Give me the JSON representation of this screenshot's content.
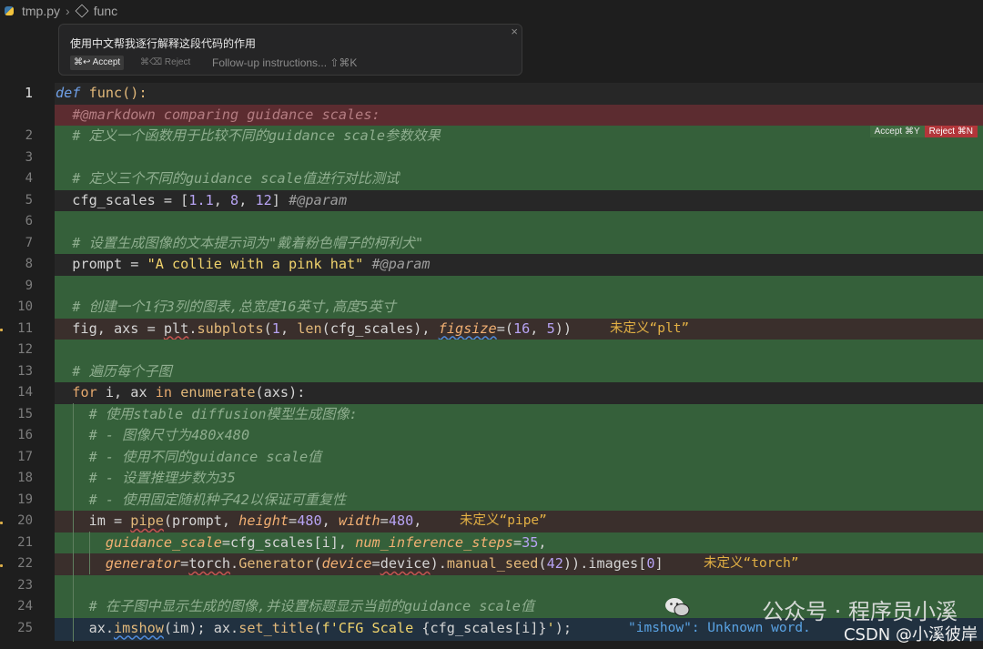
{
  "breadcrumb": {
    "file": "tmp.py",
    "symbol": "func"
  },
  "prompt_panel": {
    "prompt": "使用中文帮我逐行解释这段代码的作用",
    "accept": "⌘↩ Accept",
    "reject": "⌘⌫ Reject",
    "followup_placeholder": "Follow-up instructions... ⇧⌘K",
    "close": "×"
  },
  "diff_buttons": {
    "accept": "Accept ⌘Y",
    "reject": "Reject ⌘N"
  },
  "lines": {
    "l1": {
      "num": "1"
    },
    "l2": {
      "num": "2"
    },
    "l3": {
      "num": "3"
    },
    "l4": {
      "num": "4"
    },
    "l5": {
      "num": "5"
    },
    "l6": {
      "num": "6"
    },
    "l7": {
      "num": "7"
    },
    "l8": {
      "num": "8"
    },
    "l9": {
      "num": "9"
    },
    "l10": {
      "num": "10"
    },
    "l11": {
      "num": "11"
    },
    "l12": {
      "num": "12"
    },
    "l13": {
      "num": "13"
    },
    "l14": {
      "num": "14"
    },
    "l15": {
      "num": "15"
    },
    "l16": {
      "num": "16"
    },
    "l17": {
      "num": "17"
    },
    "l18": {
      "num": "18"
    },
    "l19": {
      "num": "19"
    },
    "l20": {
      "num": "20"
    },
    "l21": {
      "num": "21"
    },
    "l22": {
      "num": "22"
    },
    "l23": {
      "num": "23"
    },
    "l24": {
      "num": "24"
    },
    "l25": {
      "num": "25"
    }
  },
  "code": {
    "l1_def": "def",
    "l1_rest": " func():",
    "removed": "  #@markdown comparing guidance scales:",
    "l2": "  # 定义一个函数用于比较不同的guidance scale参数效果",
    "l4": "  # 定义三个不同的guidance scale值进行对比测试",
    "l5_a": "  cfg_scales = [",
    "l5_n1": "1.1",
    "l5_c1": ", ",
    "l5_n2": "8",
    "l5_c2": ", ",
    "l5_n3": "12",
    "l5_b": "] ",
    "l5_cm": "#@param",
    "l7": "  # 设置生成图像的文本提示词为\"戴着粉色帽子的柯利犬\"",
    "l8_a": "  prompt = ",
    "l8_str": "\"A collie with a pink hat\"",
    "l8_cm": " #@param",
    "l10": "  # 创建一个1行3列的图表,总宽度16英寸,高度5英寸",
    "l11_a": "  fig, axs = ",
    "l11_plt": "plt",
    "l11_b": ".",
    "l11_fn": "subplots",
    "l11_c": "(",
    "l11_n1": "1",
    "l11_d": ", ",
    "l11_len": "len",
    "l11_e": "(cfg_scales), ",
    "l11_p": "figsize",
    "l11_f": "=(",
    "l11_n2": "16",
    "l11_g": ", ",
    "l11_n3": "5",
    "l11_h": "))",
    "l13": "  # 遍历每个子图",
    "l14_a": "  ",
    "l14_for": "for",
    "l14_b": " i, ax ",
    "l14_in": "in",
    "l14_c": " ",
    "l14_fn": "enumerate",
    "l14_d": "(axs):",
    "l15": "    # 使用stable diffusion模型生成图像:",
    "l16": "    # - 图像尺寸为480x480",
    "l17": "    # - 使用不同的guidance scale值",
    "l18": "    # - 设置推理步数为35",
    "l19": "    # - 使用固定随机种子42以保证可重复性",
    "l20_a": "    im = ",
    "l20_pipe": "pipe",
    "l20_b": "(prompt, ",
    "l20_p1": "height",
    "l20_c": "=",
    "l20_n1": "480",
    "l20_d": ", ",
    "l20_p2": "width",
    "l20_e": "=",
    "l20_n2": "480",
    "l20_f": ",",
    "l21_a": "      ",
    "l21_p1": "guidance_scale",
    "l21_b": "=cfg_scales[i], ",
    "l21_p2": "num_inference_steps",
    "l21_c": "=",
    "l21_n": "35",
    "l21_d": ",",
    "l22_a": "      ",
    "l22_p1": "generator",
    "l22_b": "=",
    "l22_torch": "torch",
    "l22_c": ".",
    "l22_gen": "Generator",
    "l22_d": "(",
    "l22_p2": "device",
    "l22_e": "=",
    "l22_dev": "device",
    "l22_f": ").",
    "l22_ms": "manual_seed",
    "l22_g": "(",
    "l22_n1": "42",
    "l22_h": ")).images[",
    "l22_n2": "0",
    "l22_i": "]",
    "l24": "    # 在子图中显示生成的图像,并设置标题显示当前的guidance scale值",
    "l25_a": "    ax.",
    "l25_im": "imshow",
    "l25_b": "(im); ax.",
    "l25_st": "set_title",
    "l25_c": "(",
    "l25_f": "f'CFG Scale ",
    "l25_d": "{cfg_scales[i]}",
    "l25_e": "'",
    "l25_g": ");"
  },
  "diagnostics": {
    "plt": "未定义“plt”",
    "pipe": "未定义“pipe”",
    "torch": "未定义“torch”",
    "imshow": "\"imshow\": Unknown word."
  },
  "watermark": {
    "channel": "公众号 · 程序员小溪",
    "csdn": "CSDN @小溪彼岸"
  },
  "colors": {
    "added": "#35603a",
    "removed": "#5c2c30",
    "accept": "#3f6b41",
    "reject": "#b2363a"
  }
}
